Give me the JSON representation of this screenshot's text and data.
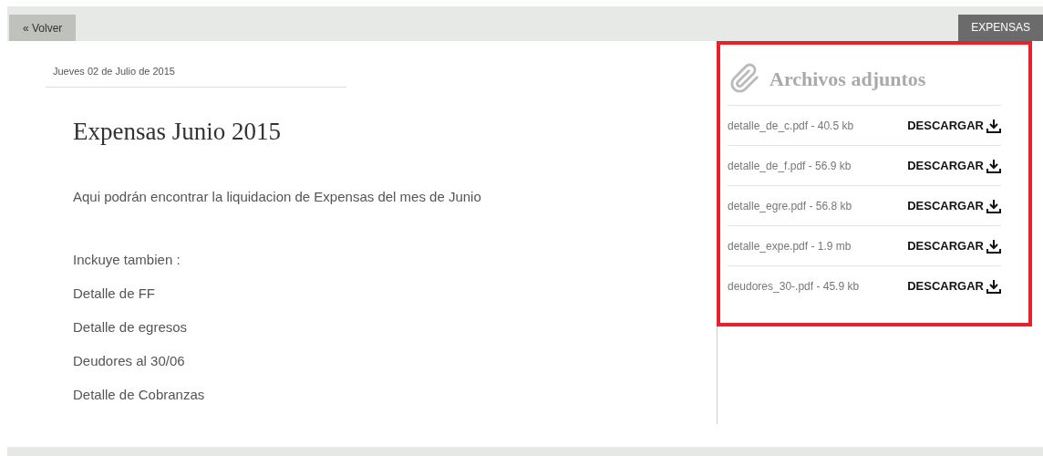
{
  "top_bar": {
    "back_button": "« Volver",
    "category_tag": "EXPENSAS"
  },
  "post": {
    "date": "Jueves 02 de Julio de 2015",
    "title": "Expensas Junio 2015",
    "intro": "Aqui podrán encontrar la liquidacion de Expensas del mes de Junio",
    "lines": [
      "Inckuye tambien :",
      "Detalle de FF",
      "Detalle de egresos",
      "Deudores al 30/06",
      "Detalle de Cobranzas"
    ]
  },
  "attachments": {
    "title": "Archivos adjuntos",
    "files": [
      {
        "name": "detalle_de_c.pdf - 40.5 kb",
        "action": "DESCARGAR"
      },
      {
        "name": "detalle_de_f.pdf - 56.9 kb",
        "action": "DESCARGAR"
      },
      {
        "name": "detalle_egre.pdf - 56.8 kb",
        "action": "DESCARGAR"
      },
      {
        "name": "detalle_expe.pdf - 1.9 mb",
        "action": "DESCARGAR"
      },
      {
        "name": "deudores_30-.pdf - 45.9 kb",
        "action": "DESCARGAR"
      }
    ]
  }
}
